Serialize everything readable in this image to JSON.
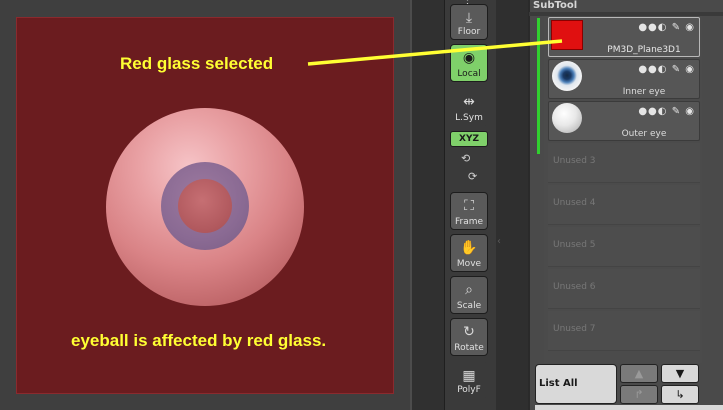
{
  "annotations": {
    "top": "Red glass selected",
    "bottom": "eyeball is affected by red glass."
  },
  "shelf": {
    "floor": "Floor",
    "local": "Local",
    "lsym": "L.Sym",
    "xyz": "XYZ",
    "frame": "Frame",
    "move": "Move",
    "scale": "Scale",
    "rotate": "Rotate",
    "polyf": "PolyF"
  },
  "subtool": {
    "title": "SubTool",
    "items": [
      {
        "name": "PM3D_Plane3D1",
        "thumb": "red-square",
        "color": "#e01010",
        "selected": true
      },
      {
        "name": "Inner eye",
        "thumb": "eye-sphere",
        "selected": false
      },
      {
        "name": "Outer eye",
        "thumb": "white-sphere",
        "selected": false
      }
    ],
    "unused": [
      "Unused 3",
      "Unused 4",
      "Unused 5",
      "Unused 6",
      "Unused 7"
    ],
    "list_all": "List All"
  },
  "colors": {
    "canvas": "#6b1c1f",
    "annotation": "#ffff33",
    "active_button": "#7fd06a",
    "visibility_bar": "#31d02f"
  }
}
